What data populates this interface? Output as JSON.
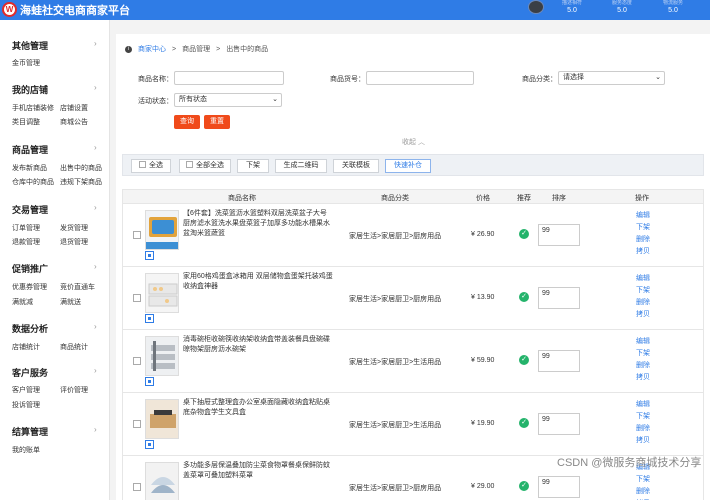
{
  "header": {
    "logo_letter": "W",
    "title": "海蛙社交电商商家平台",
    "ratings": [
      {
        "label": "描述相符",
        "value": "5.0"
      },
      {
        "label": "服务态度",
        "value": "5.0"
      },
      {
        "label": "物流服务",
        "value": "5.0"
      }
    ]
  },
  "sidebar": {
    "sections": [
      {
        "title": "其他管理",
        "items": [
          "金币管理"
        ]
      },
      {
        "title": "我的店铺",
        "items": [
          "手机店铺装修",
          "店铺设置",
          "类目调整",
          "商城公告"
        ]
      },
      {
        "title": "商品管理",
        "items": [
          "发布新商品",
          "出售中的商品",
          "仓库中的商品",
          "违规下架商品"
        ]
      },
      {
        "title": "交易管理",
        "items": [
          "订单管理",
          "发货管理",
          "退款管理",
          "退货管理"
        ]
      },
      {
        "title": "促销推广",
        "items": [
          "优惠券管理",
          "竞价直通车",
          "满就减",
          "满就送"
        ]
      },
      {
        "title": "数据分析",
        "items": [
          "店铺统计",
          "商品统计"
        ]
      },
      {
        "title": "客户服务",
        "items": [
          "客户管理",
          "评价管理",
          "投诉管理"
        ]
      },
      {
        "title": "结算管理",
        "items": [
          "我的账单"
        ]
      }
    ]
  },
  "breadcrumb": {
    "home": "商家中心",
    "sep1": ">",
    "level1": "商品管理",
    "sep2": ">",
    "level2": "出售中的商品"
  },
  "filters": {
    "name_label": "商品名称：",
    "name_value": "",
    "code_label": "商品货号：",
    "code_value": "",
    "category_label": "商品分类：",
    "category_value": "请选择",
    "status_label": "活动状态：",
    "status_value": "所有状态",
    "search_btn": "查询",
    "reset_btn": "重置",
    "collapse_label": "收起",
    "collapse_icon": "chevron-up-icon"
  },
  "toolbar": {
    "select_all": "全选",
    "select_all_pages": "全部全选",
    "unshelve": "下架",
    "gen_qr": "生成二维码",
    "relate_template": "关联模板",
    "quick_restock": "快速补仓"
  },
  "table": {
    "columns": [
      "商品名称",
      "商品分类",
      "价格",
      "推荐",
      "排序",
      "操作"
    ],
    "rows": [
      {
        "name": "【6件套】洗菜篮沥水篮塑料双层洗菜盆子大号厨房滤水篮洗水果盘菜篮子加厚多功能水槽果水盆淘米篮蔬篮",
        "category": "家居生活>家居厨卫>厨房用品",
        "price": "¥ 26.90",
        "sort": "99",
        "actions": [
          "编辑",
          "下架",
          "删除",
          "拷贝"
        ]
      },
      {
        "name": "家用60格鸡蛋盒冰箱用 双层储物盒蛋架托装鸡蛋收纳盒神器",
        "category": "家居生活>家居厨卫>厨房用品",
        "price": "¥ 13.90",
        "sort": "99",
        "actions": [
          "编辑",
          "下架",
          "删除",
          "拷贝"
        ]
      },
      {
        "name": "消毒碗柜收碗筷收纳架收纳盒带盖装餐具盘碗碟晾物架厨房沥水碗架",
        "category": "家居生活>家居厨卫>生活用品",
        "price": "¥ 59.90",
        "sort": "99",
        "actions": [
          "编辑",
          "下架",
          "删除",
          "拷贝"
        ]
      },
      {
        "name": "桌下抽屉式整理盒办公室桌面隐藏收纳盒粘贴桌底杂物盒学生文具盒",
        "category": "家居生活>家居厨卫>生活用品",
        "price": "¥ 19.90",
        "sort": "99",
        "actions": [
          "编辑",
          "下架",
          "删除",
          "拷贝"
        ]
      },
      {
        "name": "多功能多层保温叠加防尘菜食物罩餐桌保鲜防蚊盖菜罩可叠加塑料菜罩",
        "category": "家居生活>家居厨卫>厨房用品",
        "price": "¥ 29.00",
        "sort": "99",
        "actions": [
          "编辑",
          "下架",
          "删除",
          "拷贝"
        ]
      }
    ]
  },
  "watermark": "CSDN @微服务商城技术分享"
}
